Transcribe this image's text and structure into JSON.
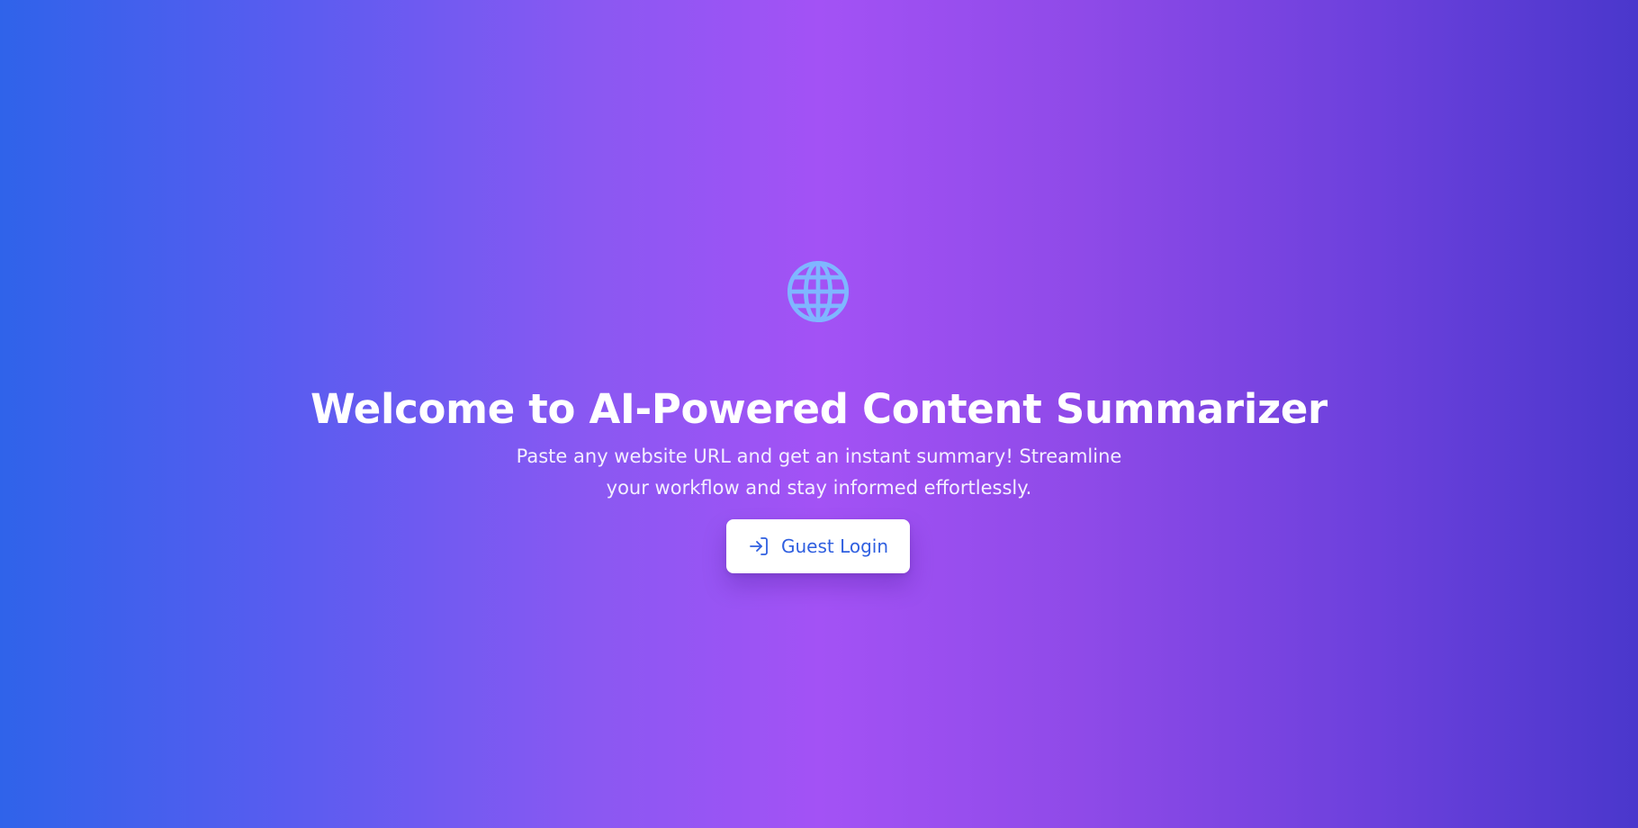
{
  "hero": {
    "icon": "globe-icon",
    "title": "Welcome to AI-Powered Content Summarizer",
    "subtitle": "Paste any website URL and get an instant summary! Streamline your workflow and stay informed effortlessly."
  },
  "login_button": {
    "label": "Guest Login",
    "icon": "login-icon"
  },
  "colors": {
    "gradient_left": "#2f63ea",
    "gradient_center": "#a352f5",
    "gradient_right": "#4a37cc",
    "globe": "#7fb6ff",
    "button_text": "#2f5fe0",
    "button_background": "#ffffff"
  }
}
